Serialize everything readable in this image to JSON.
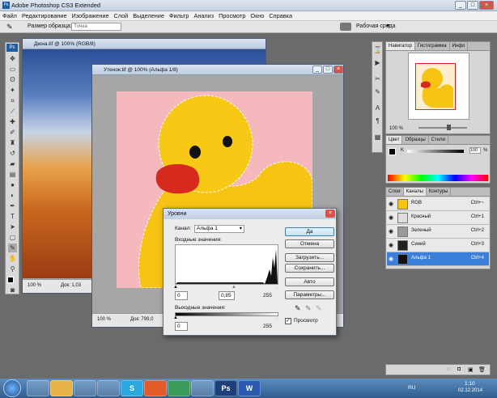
{
  "app": {
    "title": "Adobe Photoshop CS3 Extended"
  },
  "menu": [
    "Файл",
    "Редактирование",
    "Изображение",
    "Слой",
    "Выделение",
    "Фильтр",
    "Анализ",
    "Просмотр",
    "Окно",
    "Справка"
  ],
  "options": {
    "sample_label": "Размер образца:",
    "sample_value": "Точка",
    "workspace": "Рабочая среда"
  },
  "doc1": {
    "title": "Дюна.tif @ 100% (RGB/8)",
    "zoom": "100 %",
    "status": "Док: 1,03"
  },
  "doc2": {
    "title": "Утенок.tif @ 100% (Альфа 1/8)",
    "zoom": "100 %",
    "status": "Док: 799,0"
  },
  "navigator": {
    "tabs": [
      "Навигатор",
      "Гистограмма",
      "Инфо"
    ],
    "zoom": "100 %"
  },
  "color_panel": {
    "tabs": [
      "Цвет",
      "Образцы",
      "Стили"
    ],
    "channel": "K",
    "value": "100",
    "unit": "%"
  },
  "channels_panel": {
    "tabs": [
      "Слои",
      "Каналы",
      "Контуры"
    ],
    "rows": [
      {
        "name": "RGB",
        "shortcut": "Ctrl+~"
      },
      {
        "name": "Красный",
        "shortcut": "Ctrl+1"
      },
      {
        "name": "Зеленый",
        "shortcut": "Ctrl+2"
      },
      {
        "name": "Синий",
        "shortcut": "Ctrl+3"
      },
      {
        "name": "Альфа 1",
        "shortcut": "Ctrl+4"
      }
    ]
  },
  "levels": {
    "title": "Уровни",
    "channel_label": "Канал:",
    "channel_value": "Альфа 1",
    "input_label": "Входные значения:",
    "in_black": "0",
    "in_gamma": "0,85",
    "in_white": "255",
    "output_label": "Выходные значения:",
    "out_black": "0",
    "out_white": "255",
    "buttons": {
      "ok": "Да",
      "cancel": "Отмена",
      "load": "Загрузить...",
      "save": "Сохранить...",
      "auto": "Авто",
      "options": "Параметры..."
    },
    "preview": "Просмотр"
  },
  "taskbar": {
    "lang": "RU",
    "time": "1:10",
    "date": "02.12.2014",
    "apps": [
      "",
      "",
      "",
      "",
      "S",
      "",
      "",
      "",
      "Ps",
      "W"
    ]
  },
  "colors": {
    "accent": "#3a7fd9",
    "duck_bg": "#f5b8bd"
  }
}
